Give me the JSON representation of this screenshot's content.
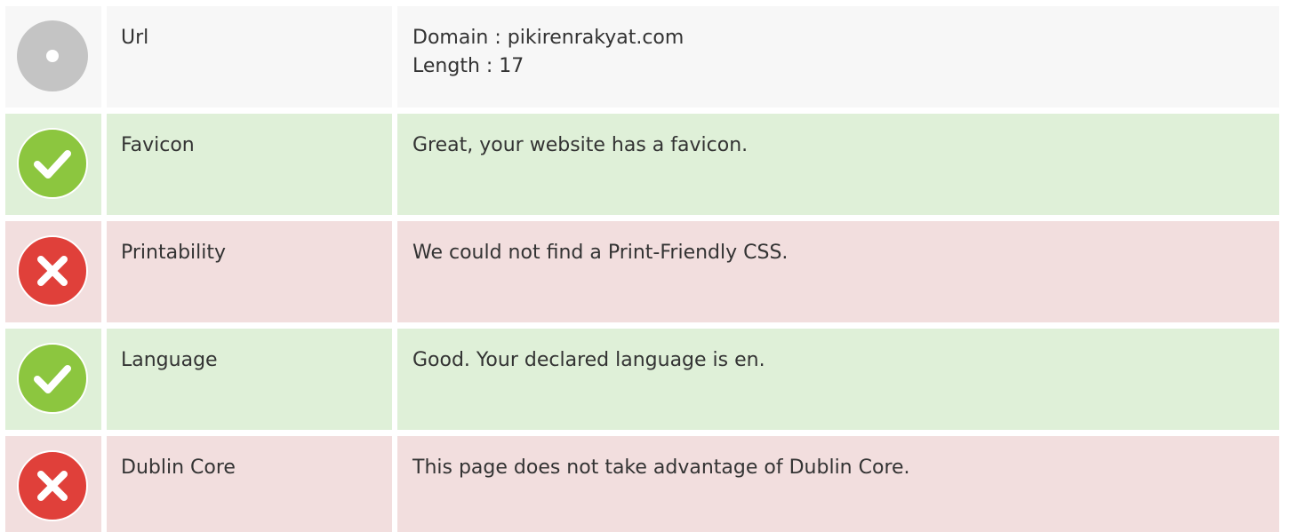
{
  "colors": {
    "neutral_bg": "#f7f7f7",
    "pass_bg": "#dff0d8",
    "fail_bg": "#f2dede",
    "pass_icon": "#8cc63f",
    "fail_icon": "#e0403a",
    "neutral_icon": "#c4c4c4"
  },
  "rows": [
    {
      "status": "neutral",
      "icon": "neutral-dot-icon",
      "label": "Url",
      "lines": [
        "Domain : pikirenrakyat.com",
        "Length : 17"
      ]
    },
    {
      "status": "pass",
      "icon": "check-icon",
      "label": "Favicon",
      "lines": [
        "Great, your website has a favicon."
      ]
    },
    {
      "status": "fail",
      "icon": "cross-icon",
      "label": "Printability",
      "lines": [
        "We could not find a Print-Friendly CSS."
      ]
    },
    {
      "status": "pass",
      "icon": "check-icon",
      "label": "Language",
      "lines": [
        "Good. Your declared language is en."
      ]
    },
    {
      "status": "fail",
      "icon": "cross-icon",
      "label": "Dublin Core",
      "lines": [
        "This page does not take advantage of Dublin Core."
      ]
    }
  ]
}
